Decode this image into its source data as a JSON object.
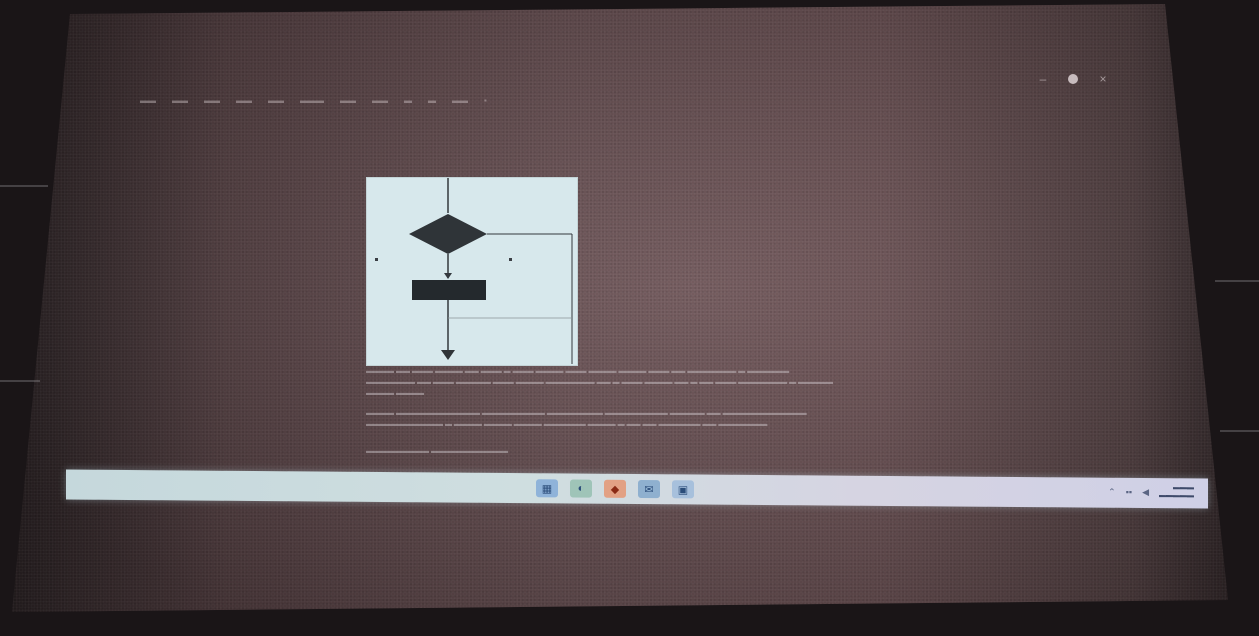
{
  "window": {
    "title": "",
    "controls": [
      "minimize",
      "restore",
      "close"
    ]
  },
  "menubar": {
    "items": [
      "",
      "",
      "",
      "",
      "",
      "",
      "",
      "",
      "",
      "",
      "",
      ""
    ]
  },
  "figure": {
    "type": "flowchart",
    "decision_label": "",
    "process_label": "",
    "left_branch_label": "",
    "right_branch_label": ""
  },
  "paragraphs": [
    [
      "",
      "",
      ""
    ],
    [
      "",
      ""
    ],
    [
      ""
    ]
  ],
  "taskbar": {
    "apps": [
      "file-explorer-icon",
      "edge-icon",
      "office-icon",
      "mail-icon",
      "store-icon"
    ],
    "tray_time": "",
    "tray_date": ""
  },
  "colors": {
    "taskbar": "#cfdee0",
    "figure_bg": "#d7e8ec",
    "screen": "#6b5255"
  }
}
